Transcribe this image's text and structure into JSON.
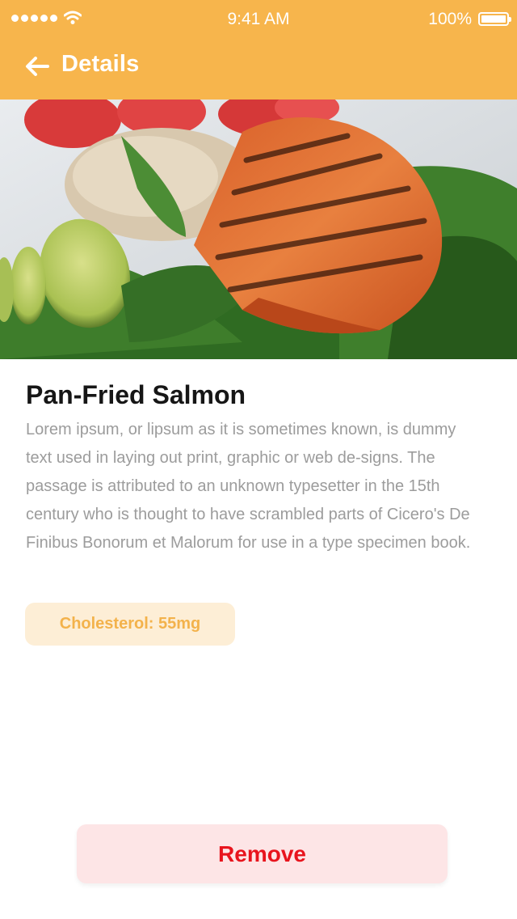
{
  "status_bar": {
    "time": "9:41 AM",
    "battery": "100%",
    "icons": [
      "signal-dots",
      "wifi-icon",
      "battery-icon"
    ]
  },
  "nav": {
    "back_icon": "arrow-left-icon",
    "title": "Details"
  },
  "hero_image": {
    "subject": "grilled salmon with brown rice, avocado, spinach and tomatoes",
    "accent": "#f7b54c"
  },
  "dish": {
    "title": "Pan-Fried Salmon",
    "description": "Lorem ipsum, or lipsum as it is sometimes known, is dummy text used in laying out print, graphic or web de-signs. The passage is attributed to an unknown typesetter in the 15th century who is thought to have scrambled parts of Cicero's De Finibus Bonorum et Malorum for use in a type specimen book."
  },
  "nutrition_badge": {
    "label": "Cholesterol: 55mg"
  },
  "actions": {
    "remove_label": "Remove"
  },
  "colors": {
    "header": "#f7b54c",
    "badge_bg": "#fdeed6",
    "badge_text": "#f3b24b",
    "remove_bg": "#fde5e6",
    "remove_text": "#e8141d"
  }
}
